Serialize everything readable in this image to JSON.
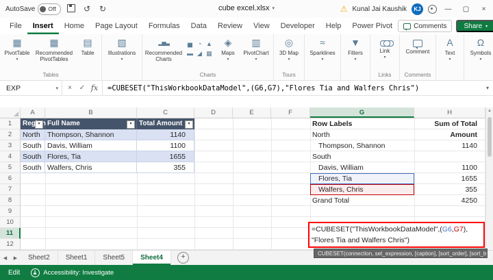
{
  "titlebar": {
    "autosave_label": "AutoSave",
    "autosave_state": "Off",
    "filename": "cube excel.xlsx",
    "user_name": "Kunal Jai Kaushik",
    "user_initials": "KJ"
  },
  "ribbon_tabs": {
    "items": [
      "File",
      "Insert",
      "Home",
      "Page Layout",
      "Formulas",
      "Data",
      "Review",
      "View",
      "Developer",
      "Help",
      "Power Pivot"
    ],
    "active": "Insert",
    "comments_button": "Comments",
    "share_button": "Share"
  },
  "ribbon": {
    "tables": {
      "caption": "Tables",
      "pivottable": "PivotTable",
      "recommended": "Recommended PivotTables",
      "table": "Table"
    },
    "illustrations": {
      "label": "Illustrations"
    },
    "charts": {
      "caption": "Charts",
      "recommended": "Recommended Charts",
      "maps": "Maps",
      "pivotchart": "PivotChart"
    },
    "tours": {
      "caption": "Tours",
      "map3d": "3D Map"
    },
    "sparklines": {
      "label": "Sparklines"
    },
    "filters": {
      "label": "Filters"
    },
    "links": {
      "caption": "Links",
      "link": "Link"
    },
    "comments_group": {
      "caption": "Comments",
      "comment": "Comment"
    },
    "text_group": {
      "label": "Text"
    },
    "symbols": {
      "label": "Symbols"
    }
  },
  "formula_bar": {
    "name_box": "EXP",
    "cancel": "×",
    "enter": "✓",
    "fx": "fx",
    "formula": "=CUBESET(\"ThisWorkbookDataModel\",(G6,G7),\"Flores Tia and Walfers Chris\")"
  },
  "grid": {
    "columns": [
      "A",
      "B",
      "C",
      "D",
      "E",
      "F",
      "G",
      "H"
    ],
    "rows": [
      "1",
      "2",
      "3",
      "4",
      "5",
      "6",
      "7",
      "8",
      "9",
      "10",
      "11",
      "12"
    ],
    "active_column": "G",
    "active_row": "11",
    "table": {
      "headers": [
        "Region",
        "Full Name",
        "Total Amount"
      ],
      "rows": [
        {
          "region": "North",
          "name": "Thompson, Shannon",
          "amount": "1140"
        },
        {
          "region": "South",
          "name": "Davis, William",
          "amount": "1100"
        },
        {
          "region": "South",
          "name": "Flores, Tia",
          "amount": "1655"
        },
        {
          "region": "South",
          "name": "Walfers, Chris",
          "amount": "355"
        }
      ]
    },
    "pivot": {
      "header_label": "Row Labels",
      "header_value": "Sum of Total Amount",
      "rows": [
        {
          "label": "North",
          "value": ""
        },
        {
          "label": "Thompson, Shannon",
          "value": "1140"
        },
        {
          "label": "South",
          "value": ""
        },
        {
          "label": "Davis, William",
          "value": "1100"
        },
        {
          "label": "Flores, Tia",
          "value": "1655"
        },
        {
          "label": "Walfers, Chris",
          "value": "355"
        },
        {
          "label": "Grand Total",
          "value": "4250"
        }
      ]
    },
    "cell_formula": {
      "part1": "=CUBESET(\"ThisWorkbookDataModel\",(",
      "ref1": "G6",
      "comma": ",",
      "ref2": "G7",
      "part2": "),",
      "line2": "\"Flores Tia and Walfers Chris\")"
    },
    "tooltip": "CUBESET(connection, set_expression, [caption], [sort_order], [sort_by])"
  },
  "sheet_bar": {
    "tabs": [
      "Sheet2",
      "Sheet1",
      "Sheet5",
      "Sheet4"
    ],
    "active": "Sheet4"
  },
  "status_bar": {
    "mode": "Edit",
    "accessibility": "Accessibility: Investigate"
  },
  "colors": {
    "excel_green": "#107C41",
    "table_header": "#44546A",
    "band_fill": "#D9E1F2",
    "ref_blue": "#4472C4",
    "ref_red": "#C00000",
    "edit_box_border": "#FF0000"
  },
  "icons": {
    "dropdown": "▾",
    "undo": "↺",
    "redo": "↻",
    "warning": "⚠",
    "minimize": "—",
    "restore": "▢",
    "close": "×",
    "scroll_up": "▲",
    "nav_left": "◀",
    "nav_right": "▶",
    "add": "+",
    "pivottable": "▦",
    "rec_pivot": "▦",
    "table": "▤",
    "illustrations": "▧",
    "rec_charts": "▂▅▃",
    "maps": "◈",
    "pivotchart": "▥",
    "map3d": "◎",
    "sparklines": "≈",
    "filters": "▼",
    "text": "A",
    "symbols": "Ω",
    "chart_grid": [
      "▅",
      "◔",
      "▲",
      "▬",
      "◢",
      "▦"
    ]
  }
}
